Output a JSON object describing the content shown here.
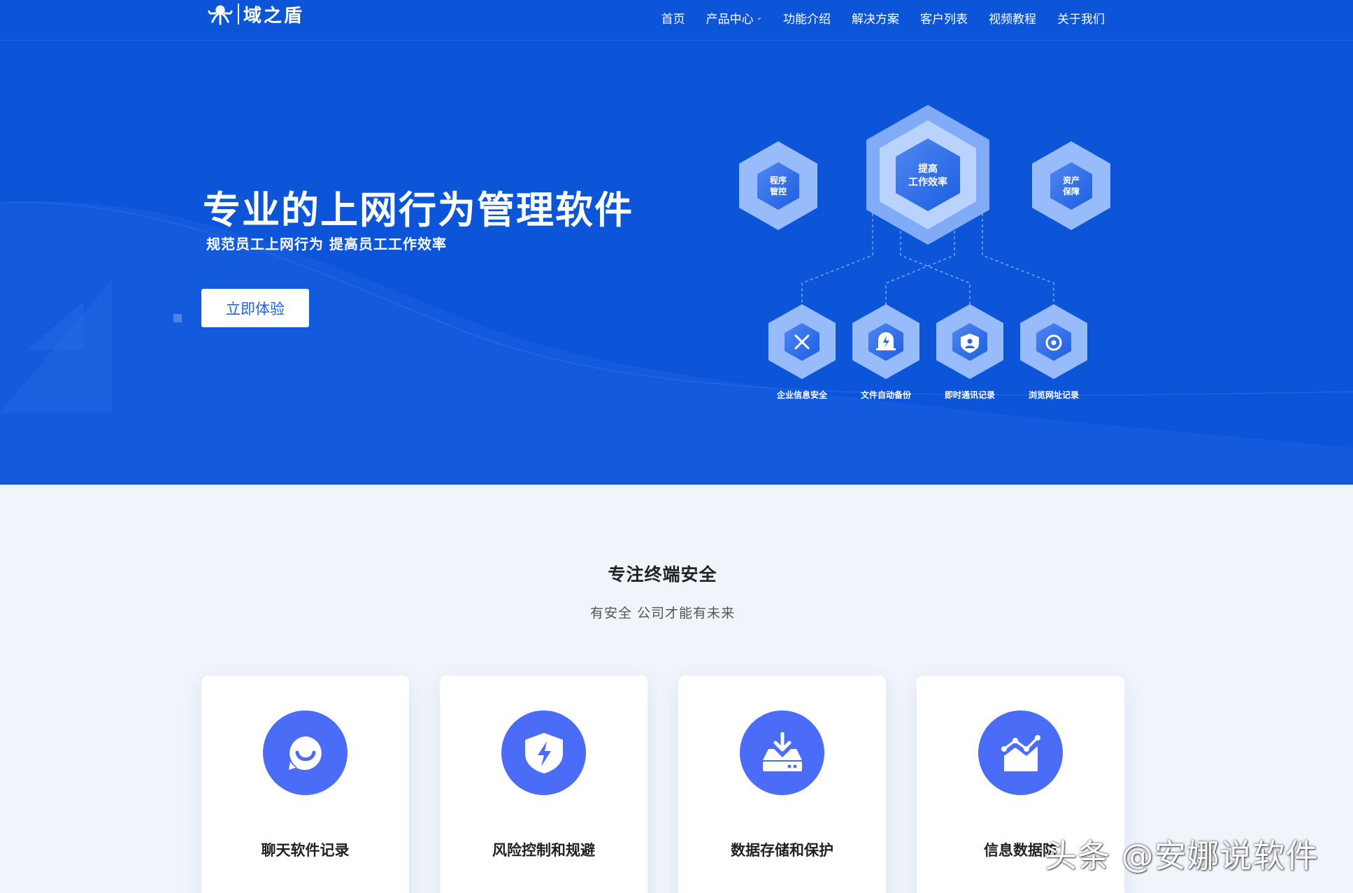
{
  "brand": {
    "name": "域之盾"
  },
  "nav": {
    "items": [
      {
        "label": "首页"
      },
      {
        "label": "产品中心",
        "has_dropdown": true
      },
      {
        "label": "功能介绍"
      },
      {
        "label": "解决方案"
      },
      {
        "label": "客户列表"
      },
      {
        "label": "视频教程"
      },
      {
        "label": "关于我们"
      }
    ]
  },
  "hero": {
    "title": "专业的上网行为管理软件",
    "subtitle": "规范员工上网行为 提高员工工作效率",
    "cta_label": "立即体验"
  },
  "diagram": {
    "center": {
      "line1": "提高",
      "line2": "工作效率"
    },
    "left": {
      "line1": "程序",
      "line2": "管控"
    },
    "right": {
      "line1": "资产",
      "line2": "保障"
    },
    "bottom": [
      {
        "label": "企业信息安全",
        "icon": "tools-icon"
      },
      {
        "label": "文件自动备份",
        "icon": "alarm-icon"
      },
      {
        "label": "即时通讯记录",
        "icon": "user-shield-icon"
      },
      {
        "label": "浏览网址记录",
        "icon": "target-icon"
      }
    ]
  },
  "features": {
    "title": "专注终端安全",
    "subtitle": "有安全 公司才能有未来",
    "cards": [
      {
        "label": "聊天软件记录",
        "icon": "chat-bubble-icon"
      },
      {
        "label": "风险控制和规避",
        "icon": "shield-bolt-icon"
      },
      {
        "label": "数据存储和保护",
        "icon": "storage-download-icon"
      },
      {
        "label": "信息数据防",
        "icon": "chart-trend-icon"
      }
    ]
  },
  "watermark": "头条 @安娜说软件",
  "colors": {
    "hero_bg": "#0d55d8",
    "accent": "#4a6cf7",
    "section_bg": "#f0f4fb"
  }
}
